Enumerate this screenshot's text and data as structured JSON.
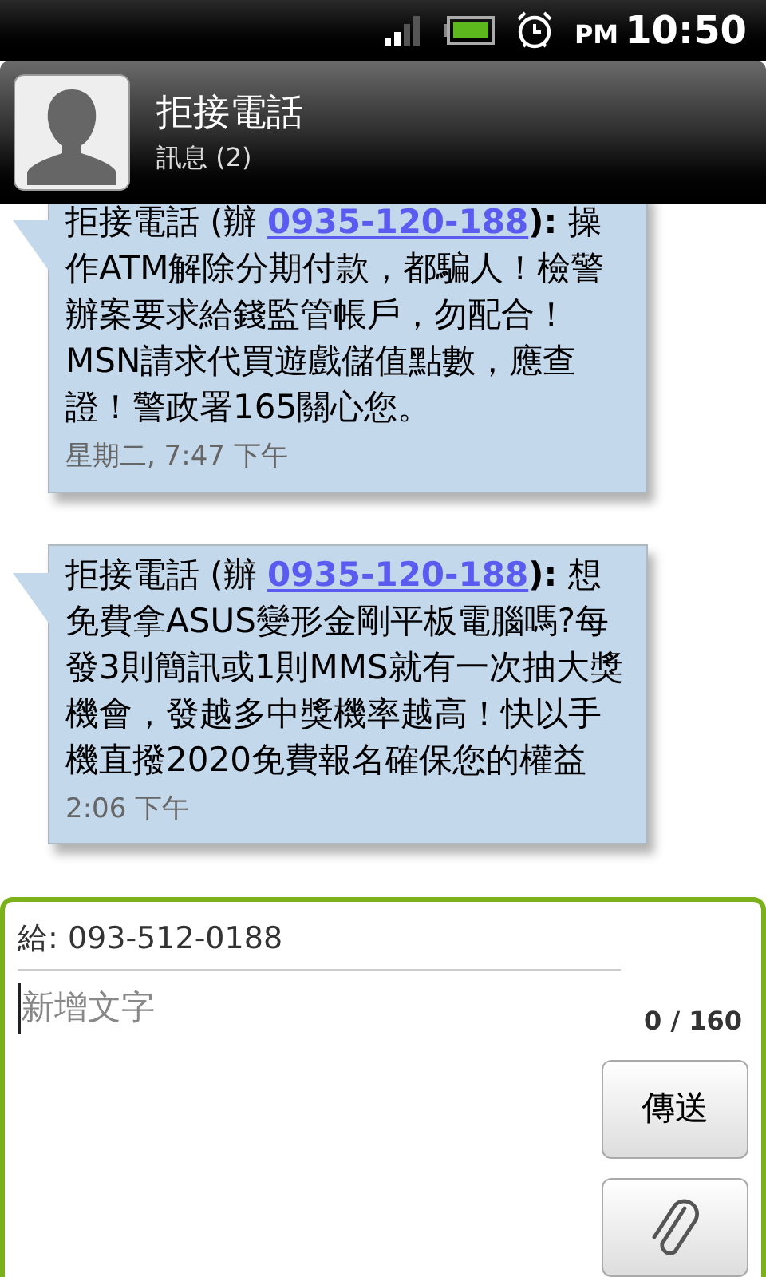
{
  "status_bar": {
    "ampm": "PM",
    "time": "10:50"
  },
  "header": {
    "title": "拒接電話",
    "subtitle": "訊息 (2)"
  },
  "messages": [
    {
      "prefix": "拒接電話 (辦 ",
      "link": "0935-120-188",
      "text": "**):** 操作ATM解除分期付款，都騙人！檢警辦案要求給錢監管帳戶，勿配合！MSN請求代買遊戲儲值點數，應查證！警政署165關心您。",
      "time": "星期二, 7:47 下午"
    },
    {
      "prefix": "拒接電話 (辦 ",
      "link": "0935-120-188",
      "text": "**):** 想免費拿ASUS變形金剛平板電腦嗎?每發3則簡訊或1則MMS就有一次抽大獎機會，發越多中獎機率越高！快以手機直撥2020免費報名確保您的權益",
      "time": "2:06 下午"
    }
  ],
  "composer": {
    "to": "給: 093-512-0188",
    "placeholder": "新增文字",
    "counter": "0 / 160",
    "send_button": "傳送"
  }
}
